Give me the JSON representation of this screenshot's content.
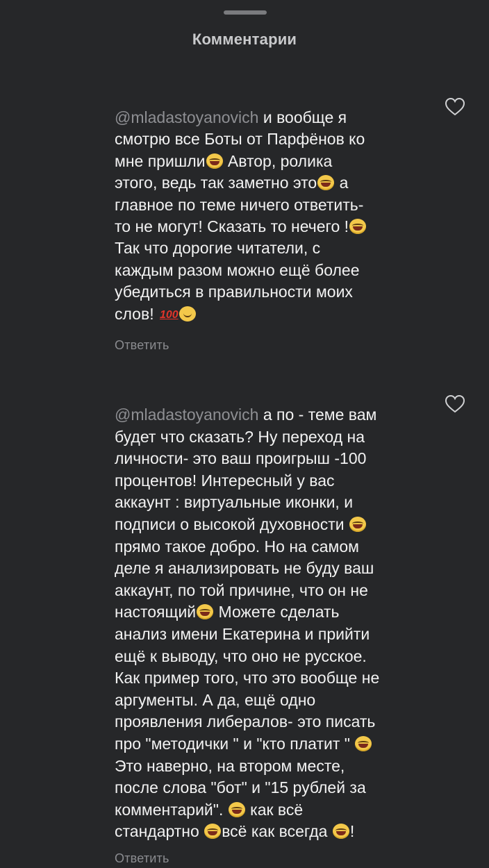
{
  "sheet": {
    "title": "Комментарии"
  },
  "comments": [
    {
      "mention": "@mladastoyanovich",
      "lines": [
        " и вообще я",
        "смотрю все Боты от Парфёнов ко",
        "мне пришли",
        "  Автор, ролика",
        "этого, ведь так заметно это",
        " а",
        "главное по теме ничего ответить-",
        "то не могут! Сказать то нечего !",
        "Так что дорогие читатели, с",
        "каждым разом можно ещё более",
        "убедиться в правильности моих",
        "слов! "
      ],
      "emoji_100": "100",
      "reply_label": "Ответить",
      "like_icon": "heart-outline-icon"
    },
    {
      "mention": "@mladastoyanovich",
      "lines": [
        "  а по - теме вам",
        "будет что сказать? Ну переход на",
        "личности- это  ваш проигрыш -100",
        "процентов! Интересный у вас",
        "аккаунт : виртуальные иконки, и",
        "подписи о высокой духовности ",
        "прямо такое добро. Но на самом",
        "деле я анализировать не буду ваш",
        "аккаунт, по той причине, что он не",
        "настоящий",
        "  Можете сделать",
        "анализ имени Екатерина и прийти",
        "ещё к выводу, что оно не русское.",
        "Как пример того, что это вообще не",
        "аргументы.  А да, ещё одно",
        "проявления либералов- это писать",
        "про \"методички \" и \"кто платит \" ",
        "Это наверно, на втором месте,",
        "после слова \"бот\" и \"15 рублей за",
        "комментарий\". ",
        " как всё",
        "стандартно ",
        "всё как всегда ",
        "!"
      ],
      "reply_label": "Ответить",
      "like_icon": "heart-outline-icon"
    }
  ],
  "colors": {
    "background": "#262729",
    "text": "#f2f2f2",
    "muted": "#8b8c90",
    "handle": "#7a7b7e"
  }
}
